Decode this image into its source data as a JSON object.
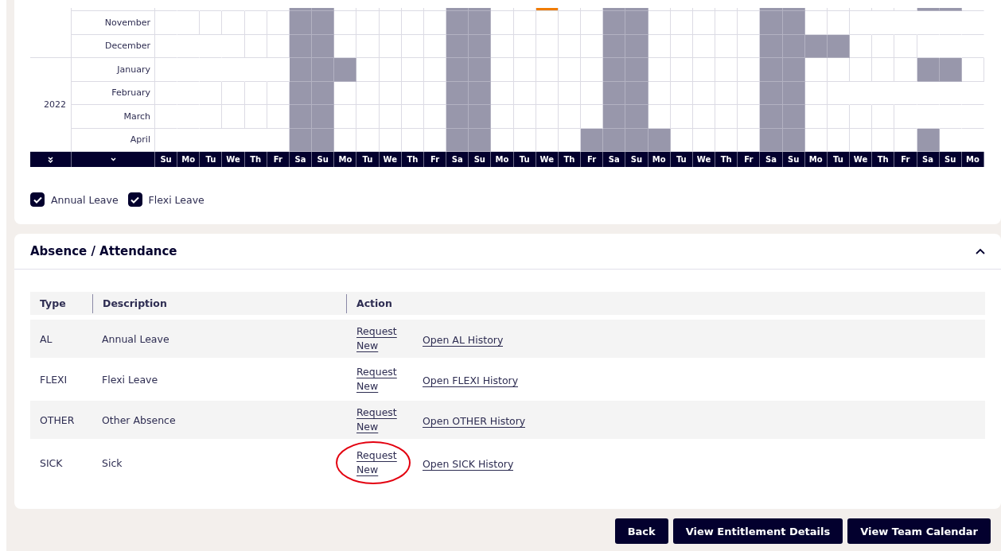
{
  "calendar": {
    "years": [
      {
        "months": [
          {
            "cells": [
              {
                "kind": "none"
              },
              {
                "kind": "none"
              },
              {
                "kind": "none"
              },
              {
                "kind": "none"
              },
              {
                "kind": "none"
              },
              {
                "kind": "day"
              },
              {
                "kind": "off"
              },
              {
                "kind": "off"
              },
              {
                "kind": "day"
              },
              {
                "kind": "day"
              },
              {
                "kind": "day"
              },
              {
                "kind": "day"
              },
              {
                "kind": "day"
              },
              {
                "kind": "off"
              },
              {
                "kind": "off"
              },
              {
                "kind": "day"
              },
              {
                "kind": "day"
              },
              {
                "kind": "leave"
              },
              {
                "kind": "day"
              },
              {
                "kind": "day"
              },
              {
                "kind": "off"
              },
              {
                "kind": "off"
              },
              {
                "kind": "day"
              },
              {
                "kind": "day"
              },
              {
                "kind": "day"
              },
              {
                "kind": "day"
              },
              {
                "kind": "day"
              },
              {
                "kind": "off"
              },
              {
                "kind": "off"
              },
              {
                "kind": "day"
              },
              {
                "kind": "day"
              },
              {
                "kind": "day"
              },
              {
                "kind": "day"
              },
              {
                "kind": "day"
              },
              {
                "kind": "off"
              },
              {
                "kind": "off"
              },
              {
                "kind": "none"
              }
            ]
          },
          {
            "name": "November",
            "cells": [
              {
                "kind": "none"
              },
              {
                "kind": "day"
              },
              {
                "kind": "day"
              },
              {
                "kind": "day"
              },
              {
                "kind": "day"
              },
              {
                "kind": "day"
              },
              {
                "kind": "off"
              },
              {
                "kind": "off"
              },
              {
                "kind": "day"
              },
              {
                "kind": "day"
              },
              {
                "kind": "day"
              },
              {
                "kind": "day"
              },
              {
                "kind": "day"
              },
              {
                "kind": "off"
              },
              {
                "kind": "off"
              },
              {
                "kind": "day"
              },
              {
                "kind": "day"
              },
              {
                "kind": "day"
              },
              {
                "kind": "day"
              },
              {
                "kind": "day"
              },
              {
                "kind": "off"
              },
              {
                "kind": "off"
              },
              {
                "kind": "day"
              },
              {
                "kind": "day"
              },
              {
                "kind": "day"
              },
              {
                "kind": "day"
              },
              {
                "kind": "day"
              },
              {
                "kind": "off"
              },
              {
                "kind": "off"
              },
              {
                "kind": "day"
              },
              {
                "kind": "day"
              },
              {
                "kind": "none"
              },
              {
                "kind": "none"
              },
              {
                "kind": "none"
              },
              {
                "kind": "none"
              },
              {
                "kind": "none"
              },
              {
                "kind": "none"
              }
            ]
          },
          {
            "name": "December",
            "cells": [
              {
                "kind": "none"
              },
              {
                "kind": "none"
              },
              {
                "kind": "none"
              },
              {
                "kind": "day"
              },
              {
                "kind": "day"
              },
              {
                "kind": "day"
              },
              {
                "kind": "off"
              },
              {
                "kind": "off"
              },
              {
                "kind": "day"
              },
              {
                "kind": "day"
              },
              {
                "kind": "day"
              },
              {
                "kind": "day"
              },
              {
                "kind": "day"
              },
              {
                "kind": "off"
              },
              {
                "kind": "off"
              },
              {
                "kind": "day"
              },
              {
                "kind": "day"
              },
              {
                "kind": "day"
              },
              {
                "kind": "day"
              },
              {
                "kind": "day"
              },
              {
                "kind": "off"
              },
              {
                "kind": "off"
              },
              {
                "kind": "day"
              },
              {
                "kind": "day"
              },
              {
                "kind": "day"
              },
              {
                "kind": "day"
              },
              {
                "kind": "day"
              },
              {
                "kind": "off"
              },
              {
                "kind": "off"
              },
              {
                "kind": "off"
              },
              {
                "kind": "off"
              },
              {
                "kind": "day"
              },
              {
                "kind": "day"
              },
              {
                "kind": "day"
              },
              {
                "kind": "none"
              },
              {
                "kind": "none"
              },
              {
                "kind": "none"
              }
            ]
          }
        ]
      },
      {
        "label": "2022",
        "months": [
          {
            "name": "January",
            "cells": [
              {
                "kind": "none"
              },
              {
                "kind": "none"
              },
              {
                "kind": "none"
              },
              {
                "kind": "none"
              },
              {
                "kind": "none"
              },
              {
                "kind": "none"
              },
              {
                "kind": "off"
              },
              {
                "kind": "off"
              },
              {
                "kind": "off"
              },
              {
                "kind": "day"
              },
              {
                "kind": "day"
              },
              {
                "kind": "day"
              },
              {
                "kind": "day"
              },
              {
                "kind": "off"
              },
              {
                "kind": "off"
              },
              {
                "kind": "day"
              },
              {
                "kind": "day"
              },
              {
                "kind": "day"
              },
              {
                "kind": "day"
              },
              {
                "kind": "day"
              },
              {
                "kind": "off"
              },
              {
                "kind": "off"
              },
              {
                "kind": "day"
              },
              {
                "kind": "day"
              },
              {
                "kind": "day"
              },
              {
                "kind": "day"
              },
              {
                "kind": "day"
              },
              {
                "kind": "off"
              },
              {
                "kind": "off"
              },
              {
                "kind": "day"
              },
              {
                "kind": "day"
              },
              {
                "kind": "day"
              },
              {
                "kind": "day"
              },
              {
                "kind": "day"
              },
              {
                "kind": "off"
              },
              {
                "kind": "off"
              },
              {
                "kind": "day"
              }
            ]
          },
          {
            "name": "February",
            "cells": [
              {
                "kind": "none"
              },
              {
                "kind": "none"
              },
              {
                "kind": "day"
              },
              {
                "kind": "day"
              },
              {
                "kind": "day"
              },
              {
                "kind": "day"
              },
              {
                "kind": "off"
              },
              {
                "kind": "off"
              },
              {
                "kind": "day"
              },
              {
                "kind": "day"
              },
              {
                "kind": "day"
              },
              {
                "kind": "day"
              },
              {
                "kind": "day"
              },
              {
                "kind": "off"
              },
              {
                "kind": "off"
              },
              {
                "kind": "day"
              },
              {
                "kind": "day"
              },
              {
                "kind": "day"
              },
              {
                "kind": "day"
              },
              {
                "kind": "day"
              },
              {
                "kind": "off"
              },
              {
                "kind": "off"
              },
              {
                "kind": "day"
              },
              {
                "kind": "day"
              },
              {
                "kind": "day"
              },
              {
                "kind": "day"
              },
              {
                "kind": "day"
              },
              {
                "kind": "off"
              },
              {
                "kind": "off"
              },
              {
                "kind": "day"
              },
              {
                "kind": "none"
              },
              {
                "kind": "none"
              },
              {
                "kind": "none"
              },
              {
                "kind": "none"
              },
              {
                "kind": "none"
              },
              {
                "kind": "none"
              },
              {
                "kind": "none"
              }
            ]
          },
          {
            "name": "March",
            "cells": [
              {
                "kind": "none"
              },
              {
                "kind": "none"
              },
              {
                "kind": "day"
              },
              {
                "kind": "day"
              },
              {
                "kind": "day"
              },
              {
                "kind": "day"
              },
              {
                "kind": "off"
              },
              {
                "kind": "off"
              },
              {
                "kind": "day"
              },
              {
                "kind": "day"
              },
              {
                "kind": "day"
              },
              {
                "kind": "day"
              },
              {
                "kind": "day"
              },
              {
                "kind": "off"
              },
              {
                "kind": "off"
              },
              {
                "kind": "day"
              },
              {
                "kind": "day"
              },
              {
                "kind": "day"
              },
              {
                "kind": "day"
              },
              {
                "kind": "day"
              },
              {
                "kind": "off"
              },
              {
                "kind": "off"
              },
              {
                "kind": "day"
              },
              {
                "kind": "day"
              },
              {
                "kind": "day"
              },
              {
                "kind": "day"
              },
              {
                "kind": "day"
              },
              {
                "kind": "off"
              },
              {
                "kind": "off"
              },
              {
                "kind": "day"
              },
              {
                "kind": "day"
              },
              {
                "kind": "day"
              },
              {
                "kind": "day"
              },
              {
                "kind": "none"
              },
              {
                "kind": "none"
              },
              {
                "kind": "none"
              },
              {
                "kind": "none"
              }
            ]
          },
          {
            "name": "April",
            "cells": [
              {
                "kind": "none"
              },
              {
                "kind": "none"
              },
              {
                "kind": "none"
              },
              {
                "kind": "none"
              },
              {
                "kind": "none"
              },
              {
                "kind": "day"
              },
              {
                "kind": "off"
              },
              {
                "kind": "off"
              },
              {
                "kind": "day"
              },
              {
                "kind": "day"
              },
              {
                "kind": "day"
              },
              {
                "kind": "day"
              },
              {
                "kind": "day"
              },
              {
                "kind": "off"
              },
              {
                "kind": "off"
              },
              {
                "kind": "day"
              },
              {
                "kind": "day"
              },
              {
                "kind": "day"
              },
              {
                "kind": "day"
              },
              {
                "kind": "off"
              },
              {
                "kind": "off"
              },
              {
                "kind": "off"
              },
              {
                "kind": "off"
              },
              {
                "kind": "day"
              },
              {
                "kind": "day"
              },
              {
                "kind": "day"
              },
              {
                "kind": "day"
              },
              {
                "kind": "off"
              },
              {
                "kind": "off"
              },
              {
                "kind": "day"
              },
              {
                "kind": "day"
              },
              {
                "kind": "day"
              },
              {
                "kind": "day"
              },
              {
                "kind": "day"
              },
              {
                "kind": "off"
              },
              {
                "kind": "none"
              },
              {
                "kind": "none"
              }
            ]
          }
        ]
      }
    ],
    "days": [
      "Su",
      "Mo",
      "Tu",
      "We",
      "Th",
      "Fr",
      "Sa",
      "Su",
      "Mo",
      "Tu",
      "We",
      "Th",
      "Fr",
      "Sa",
      "Su",
      "Mo",
      "Tu",
      "We",
      "Th",
      "Fr",
      "Sa",
      "Su",
      "Mo",
      "Tu",
      "We",
      "Th",
      "Fr",
      "Sa",
      "Su",
      "Mo",
      "Tu",
      "We",
      "Th",
      "Fr",
      "Sa",
      "Su",
      "Mo"
    ],
    "filters": [
      {
        "label": "Annual Leave",
        "checked": true
      },
      {
        "label": "Flexi Leave",
        "checked": true
      }
    ]
  },
  "absence": {
    "title": "Absence / Attendance",
    "expanded": true,
    "columns": [
      "Type",
      "Description",
      "Action"
    ],
    "rows": [
      {
        "type": "AL",
        "description": "Annual Leave",
        "request": "Request New",
        "history": "Open AL History",
        "highlighted": false
      },
      {
        "type": "FLEXI",
        "description": "Flexi Leave",
        "request": "Request New",
        "history": "Open FLEXI History",
        "highlighted": false
      },
      {
        "type": "OTHER",
        "description": "Other Absence",
        "request": "Request New",
        "history": "Open OTHER History",
        "highlighted": false
      },
      {
        "type": "SICK",
        "description": "Sick",
        "request": "Request New",
        "history": "Open SICK History",
        "highlighted": true
      }
    ]
  },
  "buttons": [
    "Back",
    "View Entitlement Details",
    "View Team Calendar"
  ]
}
